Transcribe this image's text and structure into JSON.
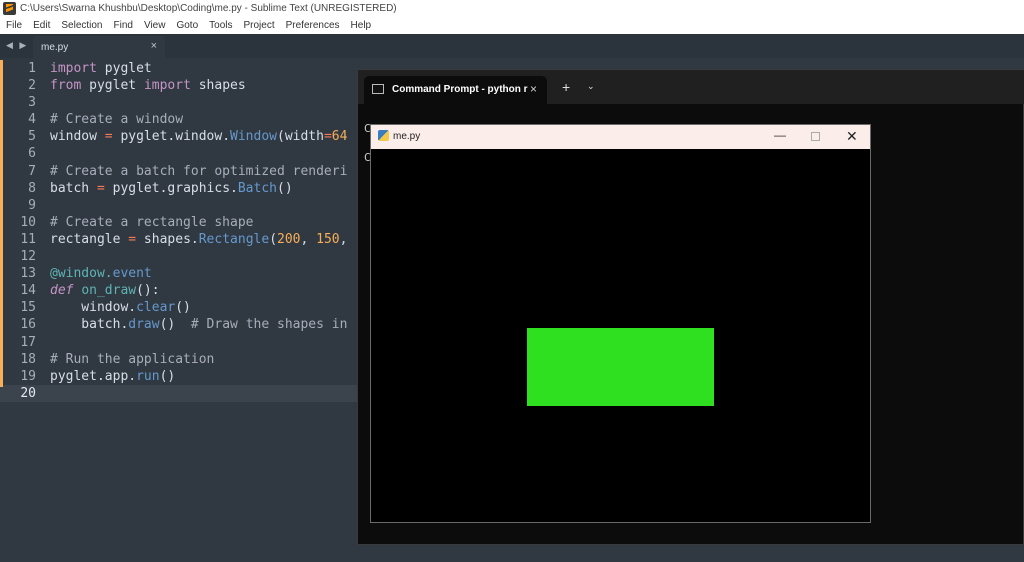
{
  "titlebar": {
    "title": "C:\\Users\\Swarna Khushbu\\Desktop\\Coding\\me.py - Sublime Text (UNREGISTERED)",
    "icon": "sublime-icon"
  },
  "menu": [
    "File",
    "Edit",
    "Selection",
    "Find",
    "View",
    "Goto",
    "Tools",
    "Project",
    "Preferences",
    "Help"
  ],
  "tab": {
    "label": "me.py",
    "close": "×"
  },
  "nav_arrows": "◀ ▶",
  "editor": {
    "line_numbers": [
      "1",
      "2",
      "3",
      "4",
      "5",
      "6",
      "7",
      "8",
      "9",
      "10",
      "11",
      "12",
      "13",
      "14",
      "15",
      "16",
      "17",
      "18",
      "19",
      "20"
    ],
    "active_line": 20
  },
  "terminal": {
    "tab_label": "Command Prompt - python  r",
    "tab_close": "×",
    "new_tab": "+",
    "dropdown": "⌄",
    "line1": "C",
    "line2": "C"
  },
  "pyglet_window": {
    "title": "me.py",
    "minimize": "—",
    "close": "✕",
    "rectangle_color": "#2fe021"
  }
}
